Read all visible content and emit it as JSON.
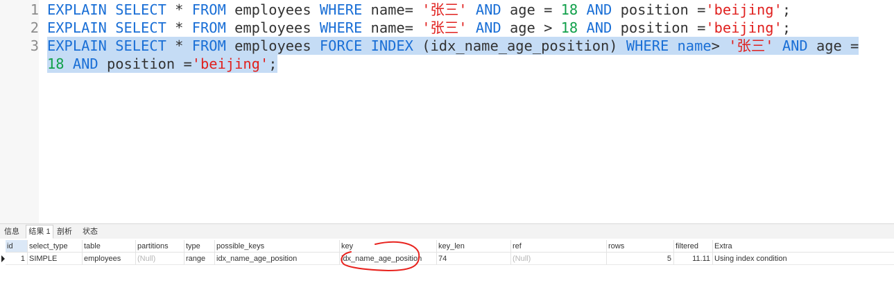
{
  "editor": {
    "lines": [
      {
        "number": "1",
        "tokens": [
          "EXPLAIN",
          " ",
          "SELECT",
          " * ",
          "FROM",
          " employees ",
          "WHERE",
          " name= ",
          "'张三'",
          " ",
          "AND",
          " age = ",
          "18",
          " ",
          "AND",
          " position =",
          "'beijing'",
          ";"
        ]
      },
      {
        "number": "2",
        "tokens": [
          "EXPLAIN",
          " ",
          "SELECT",
          " * ",
          "FROM",
          " employees ",
          "WHERE",
          " name= ",
          "'张三'",
          " ",
          "AND",
          " age > ",
          "18",
          " ",
          "AND",
          " position =",
          "'beijing'",
          ";"
        ]
      },
      {
        "number": "3",
        "tokens": [
          "EXPLAIN",
          " ",
          "SELECT",
          " * ",
          "FROM",
          " employees ",
          "FORCE",
          " ",
          "INDEX",
          " (idx_name_age_position) ",
          "WHERE",
          " ",
          "name",
          "> ",
          "'张三'",
          " ",
          "AND",
          " age ="
        ],
        "wrap_tokens": [
          "18",
          " ",
          "AND",
          " position =",
          "'beijing'",
          ";"
        ]
      }
    ]
  },
  "tabs": [
    "信息",
    "结果 1",
    "剖析",
    "状态"
  ],
  "result": {
    "columns": [
      "id",
      "select_type",
      "table",
      "partitions",
      "type",
      "possible_keys",
      "key",
      "key_len",
      "ref",
      "rows",
      "filtered",
      "Extra"
    ],
    "row": [
      "1",
      "SIMPLE",
      "employees",
      "(Null)",
      "range",
      "idx_name_age_position",
      "idx_name_age_position",
      "74",
      "(Null)",
      "5",
      "11.11",
      "Using index condition"
    ]
  },
  "colors": {
    "keyword": "#1a6fd6",
    "string": "#e0211f",
    "number": "#11a04a",
    "selection": "#c5dcf5",
    "annotation": "#e8231e"
  }
}
